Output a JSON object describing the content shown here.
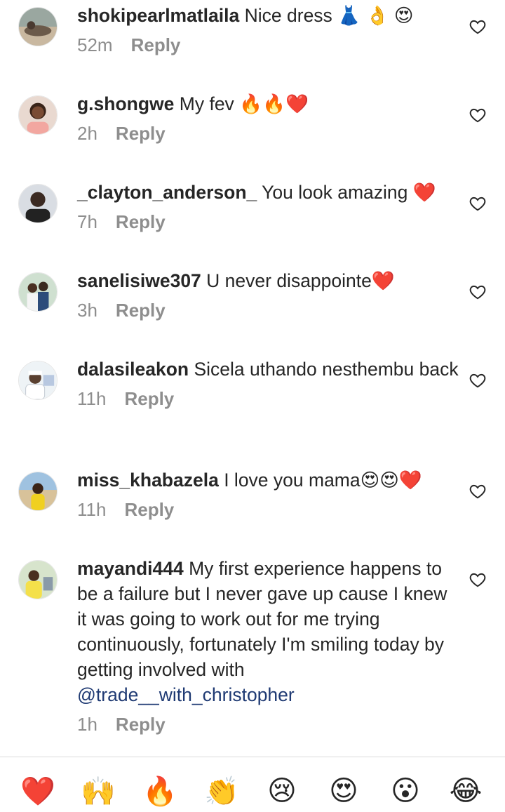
{
  "comments": [
    {
      "username": "shokipearlmatlaila",
      "text": "Nice dress 👗 👌 😍",
      "time": "52m",
      "reply": "Reply"
    },
    {
      "username": "g.shongwe",
      "text": "My fev 🔥🔥❤️",
      "time": "2h",
      "reply": "Reply"
    },
    {
      "username": "_clayton_anderson_",
      "text": "You look amazing ❤️",
      "time": "7h",
      "reply": "Reply"
    },
    {
      "username": "sanelisiwe307",
      "text": "U never disappointe❤️",
      "time": "3h",
      "reply": "Reply"
    },
    {
      "username": "dalasileakon",
      "text": "Sicela uthando nesthembu back",
      "time": "11h",
      "reply": "Reply"
    },
    {
      "username": "miss_khabazela",
      "text": "I love you mama😍😍❤️",
      "time": "11h",
      "reply": "Reply"
    },
    {
      "username": "mayandi444",
      "text": "My first experience happens to be a failure but I never gave up cause  I knew it was going to work out for me trying continuously, fortunately I'm smiling today by getting involved with",
      "mention": "@trade__with_christopher",
      "time": "1h",
      "reply": "Reply"
    }
  ],
  "reactions": [
    "❤️",
    "🙌",
    "🔥",
    "👏",
    "😢",
    "😍",
    "😮",
    "😂"
  ],
  "icons": {
    "like": "heart-outline-icon"
  }
}
